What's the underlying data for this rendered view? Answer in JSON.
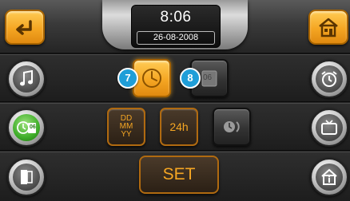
{
  "header": {
    "time": "8:06",
    "date": "26-08-2008",
    "back_icon": "back-arrow-icon",
    "home_icon": "home-icon"
  },
  "left_menu": [
    {
      "icon": "music-note-icon"
    },
    {
      "icon": "clock-date-icon",
      "label": "06",
      "active": true
    },
    {
      "icon": "door-icon"
    }
  ],
  "right_menu": [
    {
      "icon": "alarm-clock-icon"
    },
    {
      "icon": "tv-icon"
    },
    {
      "icon": "house-info-icon"
    }
  ],
  "settings": {
    "clock_button_badge": "7",
    "date_button_badge": "8",
    "date_button_label": "06",
    "date_format_label": [
      "DD",
      "MM",
      "YY"
    ],
    "hour_format_label": "24h",
    "set_label": "SET"
  },
  "colors": {
    "accent": "#f5a623",
    "badge": "#1f9ed8",
    "active_green": "#3fae2a"
  }
}
